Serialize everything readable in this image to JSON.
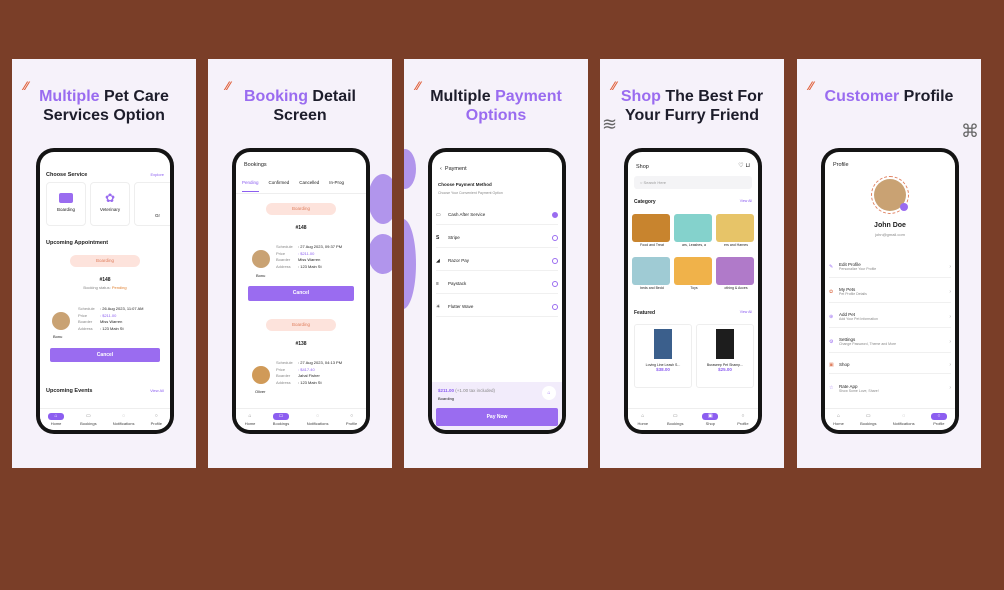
{
  "cards": [
    {
      "title_acc": "Multiple",
      "title_rest": " Pet Care",
      "title_line2": "Services Option"
    },
    {
      "title_acc": "Booking",
      "title_rest": " Detail",
      "title_line2": "Screen"
    },
    {
      "title_pre": "Multiple ",
      "title_acc": "Payment",
      "title_line2": "Options"
    },
    {
      "title_acc": "Shop",
      "title_rest": " The Best For",
      "title_line2": "Your Furry Friend"
    },
    {
      "title_acc": "Customer",
      "title_rest": " Profile"
    }
  ],
  "s1": {
    "choose": "Choose Service",
    "explore": "Explore",
    "svc1": "Boarding",
    "svc2": "Veterinary",
    "svc3": "Gr",
    "upcoming": "Upcoming Appointment",
    "pill": "Boarding",
    "id": "#148",
    "status_label": "Booking status:",
    "status": "Pending",
    "pet": "Bonu",
    "schedule_k": "Schedule",
    "schedule_v": ": 26 Aug 2023, 11:07 AM",
    "price_k": "Price",
    "price_v": ": $211.00",
    "boarder_k": "Boarder",
    "boarder_v": "Miss Warren",
    "address_k": "Address",
    "address_v": ": 123 Main St",
    "cancel": "Cancel",
    "events": "Upcoming Events",
    "viewall": "View All"
  },
  "s2": {
    "header": "Bookings",
    "tabs": [
      "Pending",
      "Confirmed",
      "Cancelled",
      "In-Prog"
    ],
    "pill": "Boarding",
    "id1": "#148",
    "pet1": "Bonu",
    "sch1": ": 27 Aug 2023, 09:37 PM",
    "price1": ": $211.00",
    "boarder1": "Miss Warren",
    "addr1": ": 123 Main St",
    "cancel": "Cancel",
    "id2": "#138",
    "pet2": "Oliver",
    "sch2": ": 27 Aug 2023, 04:13 PM",
    "price2": ": $417.40",
    "boarder2": "Jahal Fisher",
    "addr2": ": 123 Main St",
    "k_schedule": "Schedule",
    "k_price": "Price",
    "k_boarder": "Boarder",
    "k_address": "Address"
  },
  "s3": {
    "header": "Payment",
    "method": "Choose Payment Method",
    "sub": "Choose Your Convenient Payment Option",
    "options": [
      "Cash After Service",
      "Stripe",
      "Razor Pay",
      "Paystack",
      "Flutter Wave"
    ],
    "total": "$211.00",
    "tax": "(+1.00 tax included)",
    "service": "Boarding",
    "pay": "Pay Now"
  },
  "s4": {
    "header": "Shop",
    "search": "Search Here",
    "category": "Category",
    "viewall": "View All",
    "cats": [
      "Food and Treat",
      "ars, Leashes, a",
      "ers and Harnes",
      "beds and Bedd",
      "Toys",
      "othing & Acces"
    ],
    "featured": "Featured",
    "viewall2": "View All",
    "p1": "Loving Line Leash S...",
    "p1price": "$38.00",
    "p2": "Buraseep Pet Shamp...",
    "p2price": "$25.00"
  },
  "s5": {
    "header": "Profile",
    "name": "John Doe",
    "email": "john@gmail.com",
    "items": [
      {
        "t": "Edit Profile",
        "s": "Personalize Your Profile"
      },
      {
        "t": "My Pets",
        "s": "Pet Profile Details"
      },
      {
        "t": "Add Pet",
        "s": "Add Your Pet Information"
      },
      {
        "t": "Settings",
        "s": "Change Password, Theme and More"
      },
      {
        "t": "Shop",
        "s": ""
      },
      {
        "t": "Rate App",
        "s": "Show Some Love, Share!"
      }
    ]
  },
  "nav": {
    "home": "Home",
    "bookings": "Bookings",
    "notifications": "Notifications",
    "profile": "Profile",
    "shop": "Shop"
  }
}
